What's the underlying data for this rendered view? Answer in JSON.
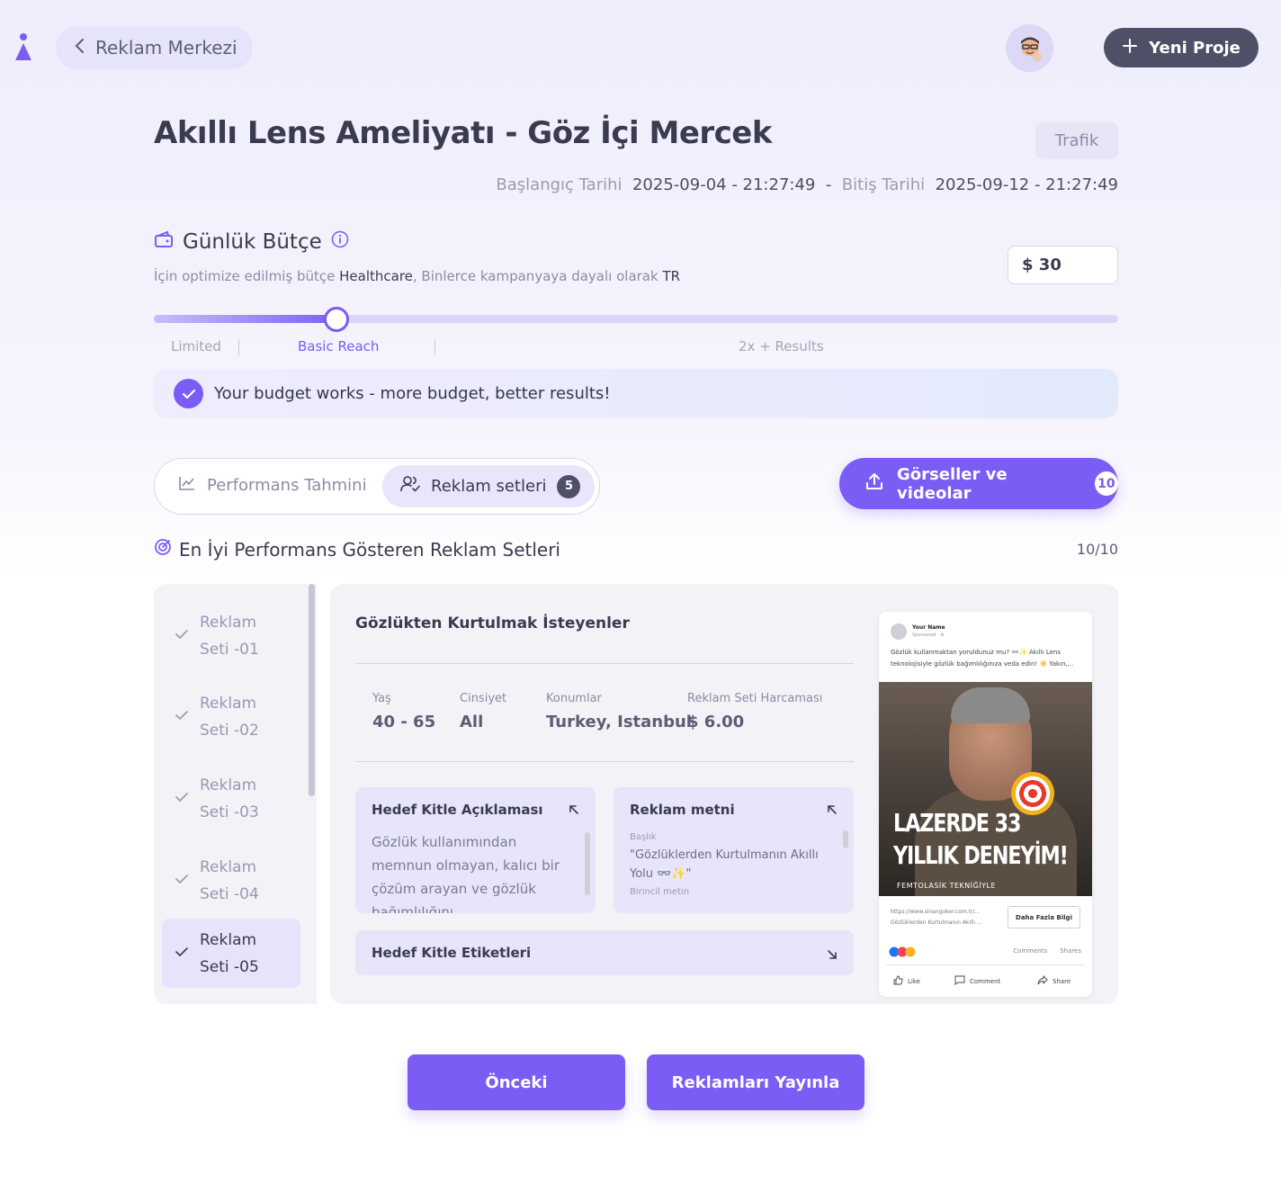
{
  "header": {
    "back_label": "Reklam Merkezi",
    "new_project_label": "Yeni Proje"
  },
  "campaign": {
    "title": "Akıllı Lens Ameliyatı - Göz İçi Mercek",
    "objective_badge": "Trafik",
    "start_label": "Başlangıç Tarihi",
    "start_value": "2025-09-04 - 21:27:49",
    "separator": "-",
    "end_label": "Bitiş Tarihi",
    "end_value": "2025-09-12 - 21:27:49"
  },
  "budget": {
    "title": "Günlük Bütçe",
    "sub_prefix": "İçin optimize edilmiş bütçe ",
    "sub_industry": "Healthcare",
    "sub_middle": ", Binlerce kampanyaya dayalı olarak ",
    "sub_country": "TR",
    "value": "$ 30",
    "slider_level_fraction": 0.19,
    "slider_labels": [
      "Limited",
      "Basic Reach",
      "2x + Results"
    ],
    "banner": "Your budget works - more budget, better results!"
  },
  "tabs": {
    "performance_label": "Performans Tahmini",
    "adsets_label": "Reklam setleri",
    "adsets_count": "5",
    "media_label": "Görseller ve videolar",
    "media_count": "10"
  },
  "section": {
    "title": "En İyi Performans Gösteren Reklam Setleri",
    "count": "10/10"
  },
  "adsets": [
    {
      "line1": "Reklam",
      "line2": "Seti -01"
    },
    {
      "line1": "Reklam",
      "line2": "Seti -02"
    },
    {
      "line1": "Reklam",
      "line2": "Seti -03"
    },
    {
      "line1": "Reklam",
      "line2": "Seti -04"
    },
    {
      "line1": "Reklam",
      "line2": "Seti -05"
    }
  ],
  "detail": {
    "title": "Gözlükten Kurtulmak İsteyenler",
    "age_label": "Yaş",
    "age_value": "40 - 65",
    "gender_label": "Cinsiyet",
    "gender_value": "All",
    "locations_label": "Konumlar",
    "locations_value": "Turkey, Istanbul",
    "spend_label": "Reklam Seti Harcaması",
    "spend_value": "$ 6.00",
    "audience_title": "Hedef Kitle Açıklaması",
    "audience_text": "Gözlük kullanımından memnun olmayan, kalıcı bir çözüm arayan ve gözlük bağımlılığını",
    "adtext_title": "Reklam metni",
    "adtext_headline_label": "Başlık",
    "adtext_headline": "\"Gözlüklerden Kurtulmanın Akıllı Yolu 👓✨\"",
    "adtext_primary_label": "Birincil metin",
    "tags_title": "Hedef Kitle Etiketleri"
  },
  "preview": {
    "name": "Your Name",
    "sponsored": "Sponsored · ⊕",
    "text": "Gözlük kullanmaktan yoruldunuz mu? 👓✨ Akıllı Lens teknolojisiyle gözlük bağımlılığınıza veda edin! ☀️ Yakın,...",
    "image_line1": "LAZERDE 33",
    "image_line2": "YILLIK DENEYİM!",
    "image_line3": "FEMTOLASİK TEKNİĞİYLE",
    "link_url": "https://www.sinangoker.com.tr/...",
    "link_title": "Gözlüklerden Kurtulmanın Akıllı ...",
    "cta": "Daha Fazla Bilgi",
    "comments": "Comments",
    "shares": "Shares",
    "like": "Like",
    "comment": "Comment",
    "share": "Share"
  },
  "footer": {
    "prev_label": "Önceki",
    "publish_label": "Reklamları Yayınla"
  },
  "colors": {
    "accent": "#7b5cf5",
    "dark_button": "#4f5068",
    "panel": "#f2f2f7"
  }
}
